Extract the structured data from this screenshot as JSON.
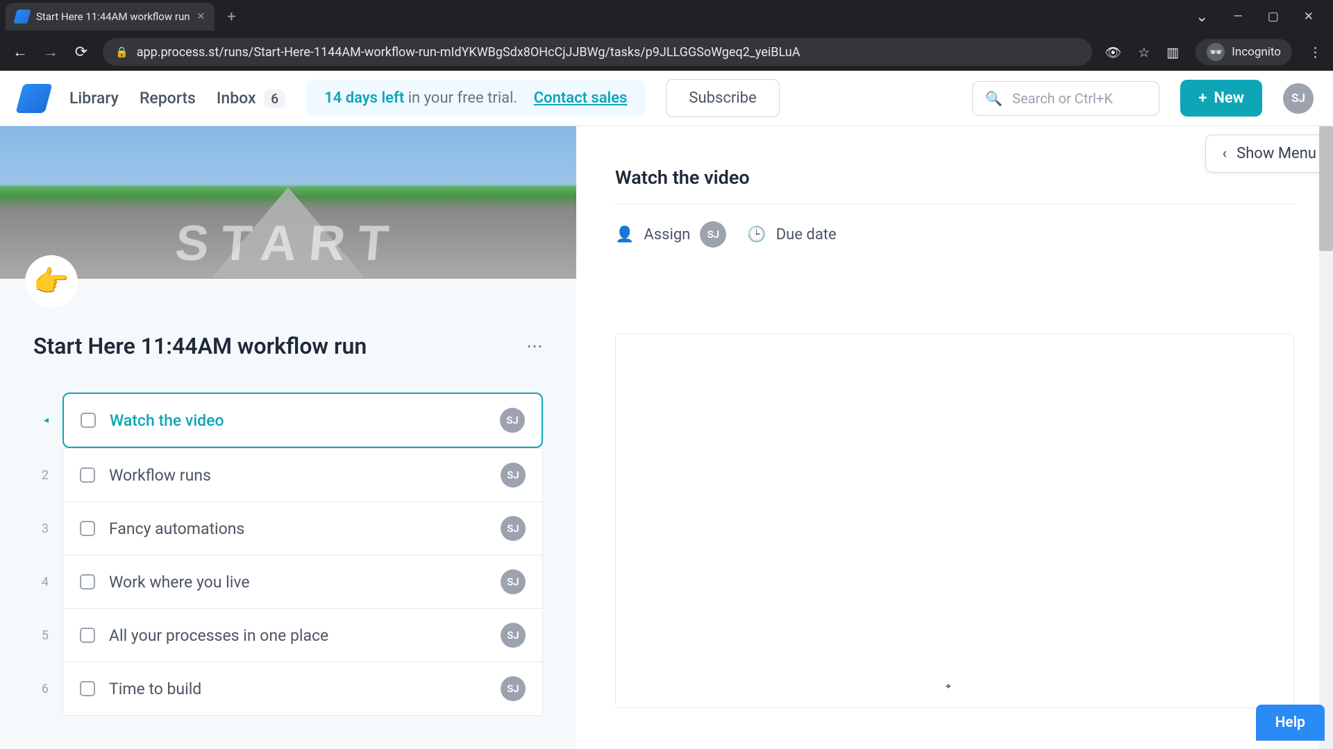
{
  "browser": {
    "tab_title": "Start Here 11:44AM workflow run",
    "url": "app.process.st/runs/Start-Here-1144AM-workflow-run-mIdYKWBgSdx8OHcCjJJBWg/tasks/p9JLLGGSoWgeq2_yeiBLuA",
    "incognito_label": "Incognito"
  },
  "header": {
    "nav": {
      "library": "Library",
      "reports": "Reports",
      "inbox": "Inbox",
      "inbox_count": "6"
    },
    "trial_days": "14 days left",
    "trial_suffix": " in your free trial.",
    "contact_sales": "Contact sales",
    "subscribe": "Subscribe",
    "search_placeholder": "Search or Ctrl+K",
    "new_label": "New",
    "user_initials": "SJ"
  },
  "left": {
    "hero_word": "START",
    "emoji": "👉",
    "run_title": "Start Here 11:44AM workflow run",
    "tasks": [
      {
        "n": "",
        "label": "Watch the video",
        "av": "SJ"
      },
      {
        "n": "2",
        "label": "Workflow runs",
        "av": "SJ"
      },
      {
        "n": "3",
        "label": "Fancy automations",
        "av": "SJ"
      },
      {
        "n": "4",
        "label": "Work where you live",
        "av": "SJ"
      },
      {
        "n": "5",
        "label": "All your processes in one place",
        "av": "SJ"
      },
      {
        "n": "6",
        "label": "Time to build",
        "av": "SJ"
      }
    ]
  },
  "right": {
    "show_menu": "Show Menu",
    "title": "Watch the video",
    "assign": "Assign",
    "assign_av": "SJ",
    "due": "Due date"
  },
  "help": "Help"
}
